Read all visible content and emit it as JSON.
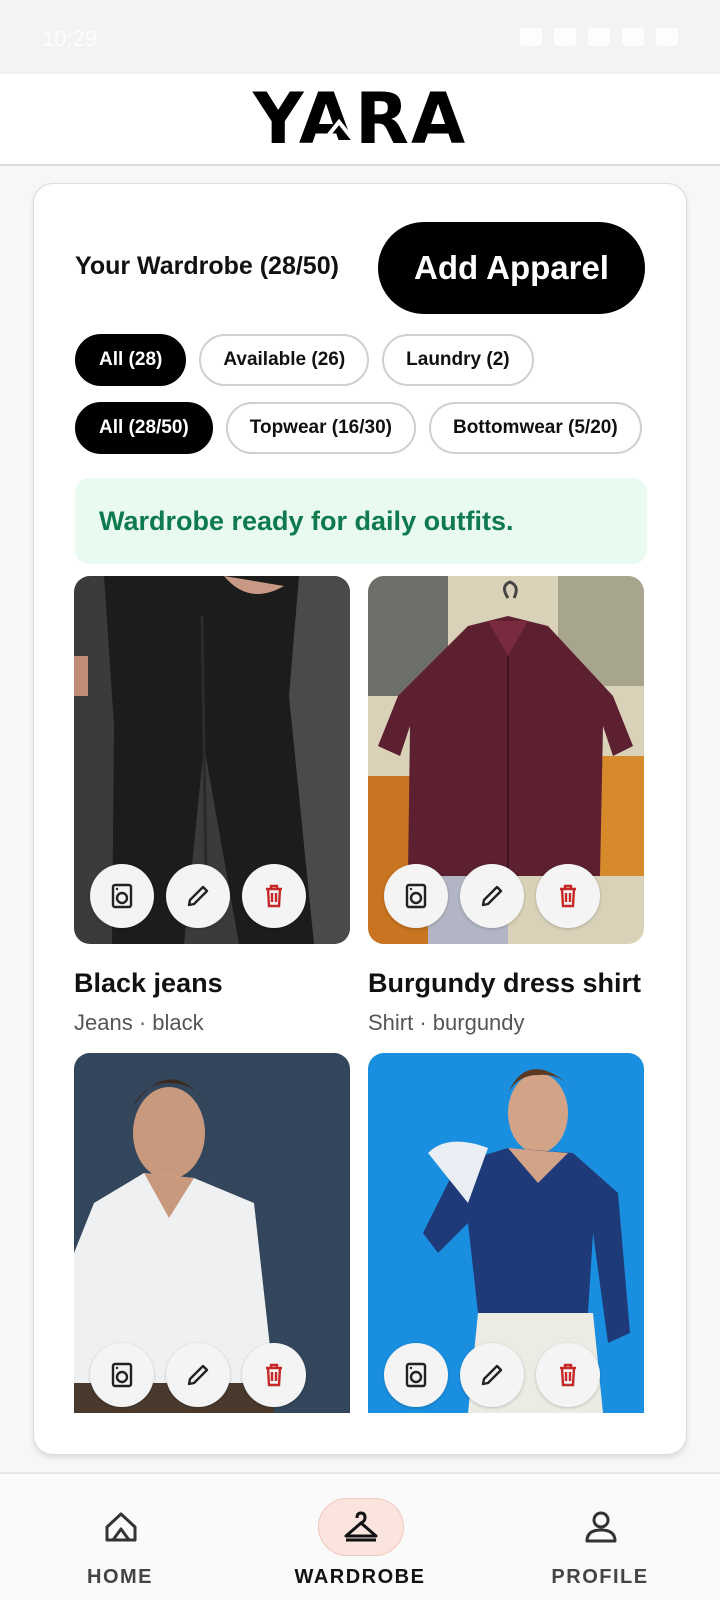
{
  "status_bar": {
    "time": "10:29"
  },
  "header": {
    "logo": "YARA"
  },
  "wardrobe": {
    "title": "Your Wardrobe (28/50)",
    "add_button": "Add Apparel",
    "status_filters": [
      {
        "label": "All (28)",
        "active": true
      },
      {
        "label": "Available (26)",
        "active": false
      },
      {
        "label": "Laundry (2)",
        "active": false
      }
    ],
    "category_filters": [
      {
        "label": "All (28/50)",
        "active": true
      },
      {
        "label": "Topwear (16/30)",
        "active": false
      },
      {
        "label": "Bottomwear (5/20)",
        "active": false
      }
    ],
    "banner": "Wardrobe ready for daily outfits.",
    "items": [
      {
        "name": "Black jeans",
        "meta": "Jeans · black"
      },
      {
        "name": "Burgundy dress shirt",
        "meta": "Shirt · burgundy"
      },
      {
        "name": "",
        "meta": ""
      },
      {
        "name": "",
        "meta": ""
      }
    ],
    "action_icons": [
      "laundry-icon",
      "edit-icon",
      "delete-icon"
    ]
  },
  "colors": {
    "accent_black": "#000000",
    "banner_bg": "#e9faf1",
    "banner_text": "#0e7a4e",
    "delete_red": "#c62828",
    "active_nav_bg": "#fbe4de"
  },
  "bottom_nav": {
    "items": [
      {
        "label": "HOME",
        "icon": "home-icon",
        "active": false
      },
      {
        "label": "WARDROBE",
        "icon": "hanger-icon",
        "active": true
      },
      {
        "label": "PROFILE",
        "icon": "person-icon",
        "active": false
      }
    ]
  }
}
